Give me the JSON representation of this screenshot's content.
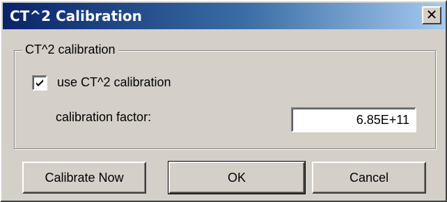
{
  "window": {
    "title": "CT^2 Calibration",
    "close_glyph": "✕"
  },
  "group": {
    "label": "CT^2 calibration"
  },
  "checkbox": {
    "label": "use CT^2 calibration",
    "checked": true
  },
  "factor": {
    "label": "calibration factor:",
    "value": "6.85E+11"
  },
  "buttons": {
    "calibrate": "Calibrate Now",
    "ok": "OK",
    "cancel": "Cancel"
  },
  "colors": {
    "face": "#d4d0c8",
    "title_start": "#0a246a",
    "title_end": "#a6caf0"
  }
}
